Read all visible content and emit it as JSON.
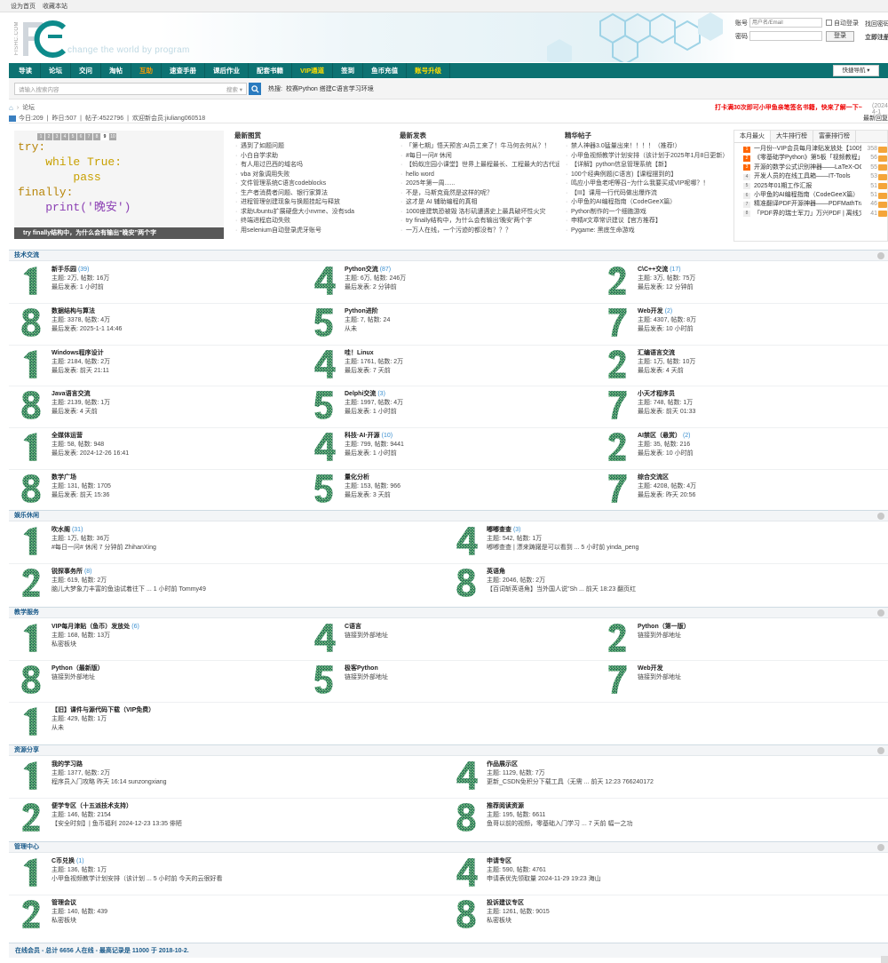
{
  "topbar": {
    "set_home": "设为首页",
    "favorite": "收藏本站"
  },
  "header": {
    "side_text": "FISHC.COM",
    "tagline": "change the world by program"
  },
  "login": {
    "account_label": "账号",
    "account_placeholder": "用户名/Email",
    "auto_login": "自动登录",
    "forgot": "找回密码",
    "password_label": "密码",
    "login_button": "登录",
    "register": "立即注册"
  },
  "nav": {
    "items": [
      {
        "label": "导读",
        "style": "normal"
      },
      {
        "label": "论坛",
        "style": "normal"
      },
      {
        "label": "交问",
        "style": "normal"
      },
      {
        "label": "淘帖",
        "style": "normal"
      },
      {
        "label": "互助",
        "style": "orange"
      },
      {
        "label": "速查手册",
        "style": "normal"
      },
      {
        "label": "课后作业",
        "style": "normal"
      },
      {
        "label": "配套书籍",
        "style": "normal"
      },
      {
        "label": "VIP通道",
        "style": "hot"
      },
      {
        "label": "签到",
        "style": "normal"
      },
      {
        "label": "鱼币充值",
        "style": "normal"
      },
      {
        "label": "账号升级",
        "style": "hot"
      }
    ],
    "quick_nav": "快捷导航 ▾"
  },
  "search": {
    "placeholder": "请输入搜索内容",
    "scope": "搜索 ▾",
    "hot_label": "热搜:",
    "hot_terms": "校赛Python  搭建C语言学习环境"
  },
  "breadcrumb": {
    "home": "⌂",
    "sep": "›",
    "current": "论坛",
    "notice": "打卡满30次即可小甲鱼亲笔签名书籍，快来了解一下~",
    "notice_date": "(2024-4-1"
  },
  "stats": {
    "today_label": "今日:",
    "today": "209",
    "yesterday_label": "昨日:",
    "yesterday": "507",
    "posts_label": "帖子:",
    "posts": "4522796",
    "welcome_label": "欢迎新会员:",
    "new_member": "jiuliang060518",
    "latest": "最新回复"
  },
  "slide": {
    "pages": [
      "1",
      "2",
      "3",
      "4",
      "5",
      "6",
      "7",
      "8",
      "9",
      "10"
    ],
    "current": "9",
    "code_lines": [
      "try:",
      "    while True:",
      "        pass",
      "finally:",
      "    print('晚安')"
    ],
    "caption": "try finally结构中，为什么会有输出“晚安”两个字"
  },
  "columns": [
    {
      "title": "最新图赏",
      "items": [
        "遇到了如题问题",
        "小白自学求助",
        "有人用过巴西的域名吗",
        "vba 对象调用失败",
        "文件管理系统C语言codeblocks",
        "生产者消费者问题、银行家算法",
        "进程管理创建现象与换题挂起与释放",
        "求助Ubuntu扩展硬盘大小nvme、没有sda",
        "终端进程启动失败",
        "用selenium自动登录虎牙账号"
      ]
    },
    {
      "title": "最新发表",
      "items": [
        "「第七期」悟天预言:AI员工来了！牛马何去何从？！",
        "#每日一问# 休闲",
        "【蚂蚁庄园小课堂】世界上最程最长、工程最大的古代运河",
        "hello word",
        "2025年第一周......",
        "不是，马斯克竟然是这样的呢？",
        "这才是 AI 辅助编程的真相",
        "1000座建筑恐被毁 洛杉矶遭遇史上最具破坏性火灾",
        "try finally结构中，为什么会有输出'晚安'两个字",
        "一万人在线，一个污迹的都没有？？？"
      ]
    },
    {
      "title": "精华帖子",
      "items": [
        "禁人神器3.0猛量出来！！！！（推荐!）",
        "小甲鱼视频教学计划安排（该计划于2025年1月8日更新）",
        "【详解】python信息管理系统【新】",
        "100个经典例题(C语言)【课程摆到的】",
        "鸣应小甲鱼老吧等召~为什么我要买成VIP呢哪？！",
        "【III】课用一行代码做出爆炸流",
        "小甲鱼的AI编程指南（CodeGeeX篇）",
        "Python制作的一个细胞游戏",
        "申精#文章常识建议【官方推荐】",
        "Pygame: 黑底生命游戏"
      ]
    }
  ],
  "rank": {
    "tabs": [
      "本月最火",
      "大牛排行榜",
      "富豪排行榜"
    ],
    "items": [
      {
        "n": "1",
        "t": "一月份--VIP会员每月津贴发放处【100鱼币...",
        "c": "358"
      },
      {
        "n": "2",
        "t": "《零基础学Python》第5板「视频教程」",
        "c": "56"
      },
      {
        "n": "3",
        "t": "开源的数学公式识别神器——LaTeX-OCR",
        "c": "55"
      },
      {
        "n": "4",
        "t": "开发人员的在线工具箱——IT-Tools",
        "c": "53"
      },
      {
        "n": "5",
        "t": "2025年01期工作汇报",
        "c": "51"
      },
      {
        "n": "6",
        "t": "小甲鱼的AI编程指南（CodeGeeX篇）",
        "c": "51"
      },
      {
        "n": "7",
        "t": "精准翻译PDF开源神器——PDFMathTranslate",
        "c": "46"
      },
      {
        "n": "8",
        "t": "「PDF界的瑞士军刀」万兴PDF | 离线文献阅...",
        "c": "41"
      }
    ]
  },
  "sections": [
    {
      "title": "技术交流",
      "cols": 3,
      "forums": [
        {
          "name": "新手乐园",
          "count": "(39)",
          "l2": "主题: 2万, 帖数: 16万",
          "l3": "最后发表: 1 小时前",
          "digit": "1"
        },
        {
          "name": "Python交流",
          "count": "(87)",
          "l2": "主题: 6万, 帖数: 246万",
          "l3": "最后发表: 2 分钟前",
          "digit": "4"
        },
        {
          "name": "C\\C++交流",
          "count": "(17)",
          "l2": "主题: 3万, 帖数: 75万",
          "l3": "最后发表: 12 分钟前",
          "digit": "2"
        },
        {
          "name": "数据结构与算法",
          "count": "",
          "l2": "主题: 3378, 帖数: 4万",
          "l3": "最后发表: 2025-1-1 14:46",
          "digit": "8"
        },
        {
          "name": "Python进阶",
          "count": "",
          "l2": "主题: 7, 帖数: 24",
          "l3": "从未",
          "digit": "5"
        },
        {
          "name": "Web开发",
          "count": "(2)",
          "l2": "主题: 4307, 帖数: 8万",
          "l3": "最后发表: 10 小时前",
          "digit": "7"
        },
        {
          "name": "Windows程序设计",
          "count": "",
          "l2": "主题: 2184, 帖数: 2万",
          "l3": "最后发表: 前天 21:11",
          "digit": "1"
        },
        {
          "name": "哇！Linux",
          "count": "",
          "l2": "主题: 1761, 帖数: 2万",
          "l3": "最后发表: 7 天前",
          "digit": "4"
        },
        {
          "name": "汇编语言交流",
          "count": "",
          "l2": "主题: 1万, 帖数: 10万",
          "l3": "最后发表: 4 天前",
          "digit": "2"
        },
        {
          "name": "Java语言交流",
          "count": "",
          "l2": "主题: 2139, 帖数: 1万",
          "l3": "最后发表: 4 天前",
          "digit": "8"
        },
        {
          "name": "Delphi交流",
          "count": "(3)",
          "l2": "主题: 1997, 帖数: 4万",
          "l3": "最后发表: 1 小时前",
          "digit": "5"
        },
        {
          "name": "小天才程序员",
          "count": "",
          "l2": "主题: 748, 帖数: 1万",
          "l3": "最后发表: 前天 01:33",
          "digit": "7"
        },
        {
          "name": "全媒体运营",
          "count": "",
          "l2": "主题: 58, 帖数: 948",
          "l3": "最后发表: 2024-12-26 16:41",
          "digit": "1"
        },
        {
          "name": "科技·AI·开源",
          "count": "(10)",
          "l2": "主题: 799, 帖数: 9441",
          "l3": "最后发表: 1 小时前",
          "digit": "4"
        },
        {
          "name": "AI禁区（悬赏）",
          "count": "(2)",
          "l2": "主题: 35, 帖数: 216",
          "l3": "最后发表: 10 小时前",
          "digit": "2"
        },
        {
          "name": "数学广场",
          "count": "",
          "l2": "主题: 131, 帖数: 1705",
          "l3": "最后发表: 前天 15:36",
          "digit": "8"
        },
        {
          "name": "量化分析",
          "count": "",
          "l2": "主题: 153, 帖数: 966",
          "l3": "最后发表: 3 天前",
          "digit": "5"
        },
        {
          "name": "综合交流区",
          "count": "",
          "l2": "主题: 4208, 帖数: 4万",
          "l3": "最后发表: 昨天 20:56",
          "digit": "7"
        }
      ]
    },
    {
      "title": "娱乐休闲",
      "cols": 2,
      "forums": [
        {
          "name": "吹水阁",
          "count": "(31)",
          "l2": "主题: 1万, 帖数: 36万",
          "l3": "#每日一问# 休闲 7 分钟前 ZhihanXing",
          "digit": "1"
        },
        {
          "name": "嘟嘟查查",
          "count": "(3)",
          "l2": "主题: 542, 帖数: 1万",
          "l3": "嘟嘟查查 | 漂来踌躇是可以看到 ... 5 小时前 yinda_peng",
          "digit": "4"
        },
        {
          "name": "锐探事务所",
          "count": "(8)",
          "l2": "主题: 619, 帖数: 2万",
          "l3": "脑儿大梦象力丰富的鱼油试着往下 ... 1 小时前 Tommy49",
          "digit": "2"
        },
        {
          "name": "英语角",
          "count": "",
          "l2": "主题: 2046, 帖数: 2万",
          "l3": "【百词斩英语角】当外国人说\"Sh ... 前天 18:23 翻页红",
          "digit": "8"
        }
      ]
    },
    {
      "title": "教学服务",
      "cols": 3,
      "forums": [
        {
          "name": "VIP每月津贴（鱼币）发放处",
          "count": "(6)",
          "l2": "主题: 168, 帖数: 13万",
          "l3": "私密板块",
          "digit": "1"
        },
        {
          "name": "C语言",
          "count": "",
          "l2": "链接到外部地址",
          "l3": "",
          "digit": "4"
        },
        {
          "name": "Python（第一版）",
          "count": "",
          "l2": "链接到外部地址",
          "l3": "",
          "digit": "2"
        },
        {
          "name": "Python（最新版）",
          "count": "",
          "l2": "链接到外部地址",
          "l3": "",
          "digit": "8"
        },
        {
          "name": "极客Python",
          "count": "",
          "l2": "链接到外部地址",
          "l3": "",
          "digit": "5"
        },
        {
          "name": "Web开发",
          "count": "",
          "l2": "链接到外部地址",
          "l3": "",
          "digit": "7"
        },
        {
          "name": "【旧】课件与源代码下载（VIP免费）",
          "count": "",
          "l2": "主题: 429, 帖数: 1万",
          "l3": "从未",
          "digit": "1"
        }
      ]
    },
    {
      "title": "资源分享",
      "cols": 2,
      "forums": [
        {
          "name": "我的学习路",
          "count": "",
          "l2": "主题: 1377, 帖数: 2万",
          "l3": "程序员入门攻略 昨天 16:14 sunzongxiang",
          "digit": "1"
        },
        {
          "name": "作品展示区",
          "count": "",
          "l2": "主题: 1129, 帖数: 7万",
          "l3": "更新_CSDN免积分下载工具（无需 ... 前天 12:23 766240172",
          "digit": "4"
        },
        {
          "name": "便学专区（十五派技术支持）",
          "count": "",
          "l2": "主题: 146, 帖数: 2154",
          "l3": "【安全时刻】| 鱼币福利 2024-12-23 13:35 俳陋",
          "digit": "2"
        },
        {
          "name": "推荐阅读资源",
          "count": "",
          "l2": "主题: 195, 帖数: 6611",
          "l3": "鱼哥以前的视频，零基础入门学习 ... 7 天前 幅一之功",
          "digit": "8"
        }
      ]
    },
    {
      "title": "管理中心",
      "cols": 2,
      "forums": [
        {
          "name": "C币兑换",
          "count": "(1)",
          "l2": "主题: 136, 帖数: 1万",
          "l3": "小甲鱼视频教学计划安排（该计划 ... 5 小时前 今天的云很好看",
          "digit": "1"
        },
        {
          "name": "申请专区",
          "count": "",
          "l2": "主题: 590, 帖数: 4761",
          "l3": "申请表优先领取量 2024-11-29 19:23 海山",
          "digit": "4"
        },
        {
          "name": "管理会议",
          "count": "",
          "l2": "主题: 140, 帖数: 439",
          "l3": "私密板块",
          "digit": "2"
        },
        {
          "name": "投诉建议专区",
          "count": "",
          "l2": "主题: 1261, 帖数: 9015",
          "l3": "私密板块",
          "digit": "8"
        }
      ]
    }
  ],
  "footer": {
    "online": "在线会员 - 总计 6656 人在线 - 最高记录是 11000 于 2018-10-2."
  },
  "colors": {
    "nav": "#0d7272",
    "accent": "#1a5a8a",
    "count": "#3a8fd0",
    "notice": "#e00000",
    "digit_green": "#1f6b50"
  }
}
